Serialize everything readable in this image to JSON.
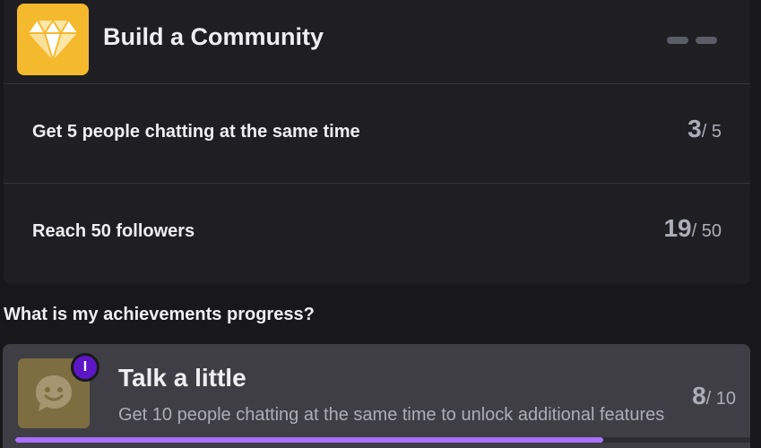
{
  "community": {
    "title": "Build a Community",
    "icon": "diamond-icon",
    "tasks": [
      {
        "label": "Get 5 people chatting at the same time",
        "current": "3",
        "total": "/ 5"
      },
      {
        "label": "Reach 50 followers",
        "current": "19",
        "total": "/ 50"
      }
    ]
  },
  "section": {
    "question": "What is my achievements progress?"
  },
  "achievement": {
    "title": "Talk a little",
    "description": "Get 10 people chatting at the same time to unlock additional features",
    "badge_text": "I",
    "icon": "smiley-chat-icon",
    "current": "8",
    "total": "/ 10",
    "progress_fraction": 0.8
  },
  "colors": {
    "background": "#18181b",
    "card": "#1f1f23",
    "accent": "#a970ff",
    "badge": "#5c16c5",
    "community_icon_bg": "#f5b92e"
  }
}
